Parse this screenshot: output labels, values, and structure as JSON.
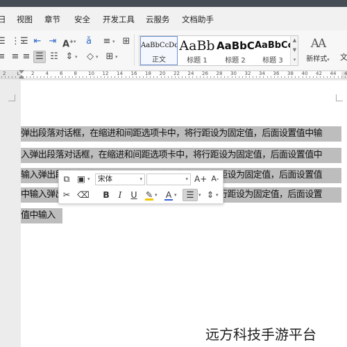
{
  "ribbon_tabs": [
    "视图",
    "章节",
    "安全",
    "开发工具",
    "云服务",
    "文档助手"
  ],
  "ribbon": {
    "row1_icons": [
      "list-indent-icon",
      "numbered-list-icon",
      "decrease-indent-icon",
      "increase-indent-icon",
      "text-effects-icon",
      "pinyin-icon",
      "line-spacing-icon",
      "table-icon"
    ],
    "row2_icons": [
      "align-left-icon",
      "align-center-icon",
      "align-right-icon",
      "justify-icon",
      "distributed-icon",
      "paragraph-spacing-icon",
      "shading-icon",
      "border-icon"
    ]
  },
  "styles_gallery": [
    {
      "sample": "AaBbCcDd",
      "name": "正文",
      "selected": true
    },
    {
      "sample": "AaBb",
      "name": "标题 1",
      "selected": false
    },
    {
      "sample": "AaBbC",
      "name": "标题 2",
      "selected": false
    },
    {
      "sample": "AaBbCc",
      "name": "标题 3",
      "selected": false
    }
  ],
  "new_style": {
    "glyph": "AA",
    "label": "新样式"
  },
  "edge_label": "文",
  "ruler_numbers": [
    "2",
    "L",
    "2",
    "4",
    "6",
    "8",
    "10",
    "12",
    "14",
    "16",
    "18",
    "20",
    "22",
    "24",
    "26",
    "28",
    "30",
    "32",
    "34",
    "36",
    "38",
    "40",
    "42",
    "44",
    "46"
  ],
  "document_lines": [
    "弹出段落对话框，在缩进和间距选项卡中，将行距设为固定值，后面设置值中输",
    "入弹出段落对话框，在缩进和间距选项卡中，将行距设为固定值，后面设置值中",
    "输入弹出段落对话框，在缩进和间距选项卡中，将行距设为固定值，后面设置值",
    "中输入弹出段落对话框，在缩进和间距选项卡中，将行距设为固定值，后面设置",
    "值中输入"
  ],
  "mini_toolbar": {
    "font_name": "宋体",
    "font_size": "",
    "grow_label": "A+",
    "shrink_label": "A-",
    "bold": "B",
    "italic": "I",
    "underline": "U",
    "font_color_label": "A"
  },
  "colors": {
    "highlight": "#bdbdbd",
    "font_color_underline": "#2f5fd0",
    "highlight_pen": "#f2c500"
  },
  "watermark": "远方科技手游平台"
}
